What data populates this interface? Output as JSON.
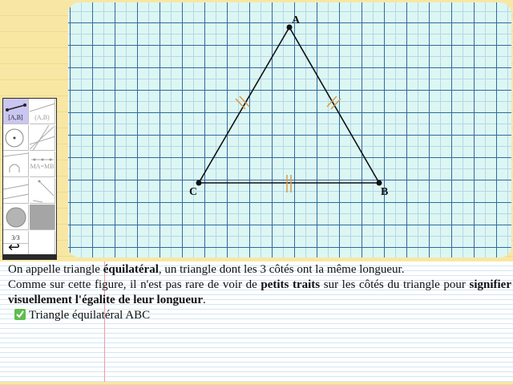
{
  "figure": {
    "points": [
      {
        "name": "A",
        "label": "A"
      },
      {
        "name": "B",
        "label": "B"
      },
      {
        "name": "C",
        "label": "C"
      }
    ],
    "stroke_color": "#111111",
    "tick_color": "#d99a4a"
  },
  "toolbar": {
    "tools": [
      {
        "id": "segment",
        "label": "[A,B]"
      },
      {
        "id": "line",
        "label": "(A,B)"
      },
      {
        "id": "circle",
        "label": ""
      },
      {
        "id": "lines-bundle",
        "label": ""
      },
      {
        "id": "arc",
        "label": "∩"
      },
      {
        "id": "equal-length",
        "label": "MA=MB"
      },
      {
        "id": "rays",
        "label": ""
      },
      {
        "id": "segments",
        "label": ""
      },
      {
        "id": "fill-circle",
        "label": ""
      },
      {
        "id": "fill-square",
        "label": ""
      },
      {
        "id": "page",
        "label": "3/3"
      },
      {
        "id": "blank",
        "label": ""
      },
      {
        "id": "undo",
        "label": "↩"
      }
    ]
  },
  "text": {
    "line1_pre": "On appelle triangle ",
    "line1_bold": "équilatéral",
    "line1_post": ", un triangle dont les 3 côtés ont la même longueur.",
    "line2_pre": "Comme sur cette figure, il n'est pas rare de voir de ",
    "line2_bold1": "petits traits",
    "line2_mid": " sur les côtés du triangle pour ",
    "line2_bold2": "signifier visuellement l'égalite de leur longueur",
    "line2_post": ".",
    "line3": "Triangle équilatéral ABC"
  },
  "colors": {
    "paper_yellow": "#f8e7a4",
    "grid_major": "#2f6a9e",
    "grid_bg": "#dcf7f3",
    "tool_selected": "#c9c6f2",
    "check_green": "#5fbd4f"
  }
}
